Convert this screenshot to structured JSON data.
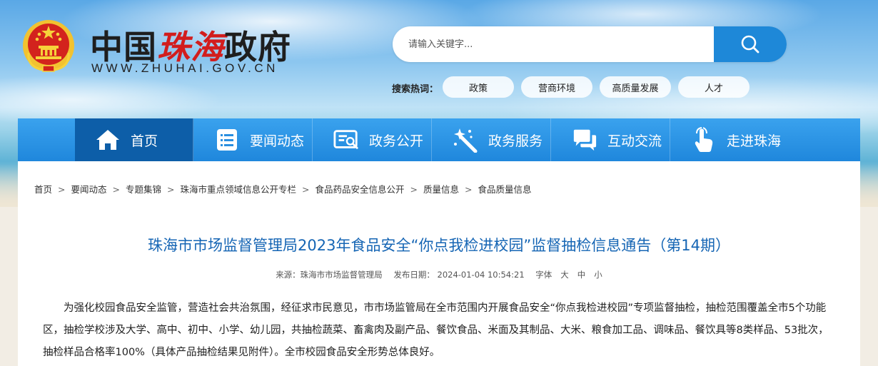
{
  "header": {
    "title_prefix": "中国",
    "title_red": "珠海",
    "title_suffix": "政府",
    "url": "WWW.ZHUHAI.GOV.CN",
    "colors": {
      "accent_red": "#d21d1d",
      "brand_blue": "#1e88d8"
    }
  },
  "search": {
    "placeholder": "请输入关键字...",
    "button_icon": "search-icon",
    "hot_label": "搜索热词：",
    "hot_tags": [
      "政策",
      "营商环境",
      "高质量发展",
      "人才"
    ]
  },
  "nav": {
    "items": [
      {
        "label": "首页",
        "icon": "home-icon",
        "active": true
      },
      {
        "label": "要闻动态",
        "icon": "news-list-icon",
        "active": false
      },
      {
        "label": "政务公开",
        "icon": "document-search-icon",
        "active": false
      },
      {
        "label": "政务服务",
        "icon": "magic-wand-icon",
        "active": false
      },
      {
        "label": "互动交流",
        "icon": "chat-icon",
        "active": false
      },
      {
        "label": "走进珠海",
        "icon": "pointer-hand-icon",
        "active": false
      }
    ]
  },
  "breadcrumb": [
    "首页",
    "要闻动态",
    "专题集锦",
    "珠海市重点领域信息公开专栏",
    "食品药品安全信息公开",
    "质量信息",
    "食品质量信息"
  ],
  "article": {
    "title": "珠海市市场监督管理局2023年食品安全“你点我检进校园”监督抽检信息通告（第14期）",
    "source": "来源：珠海市市场监督管理局",
    "date": "发布日期： 2024-01-04 10:54:21",
    "font_label": "字体",
    "font_sizes": [
      "大",
      "中",
      "小"
    ],
    "paragraph": "为强化校园食品安全监管，营造社会共治氛围，经征求市民意见，市市场监管局在全市范围内开展食品安全“你点我检进校园”专项监督抽检，抽检范围覆盖全市5个功能区，抽检学校涉及大学、高中、初中、小学、幼儿园，共抽检蔬菜、畜禽肉及副产品、餐饮食品、米面及其制品、大米、粮食加工品、调味品、餐饮具等8类样品、53批次，抽检样品合格率100%（具体产品抽检结果见附件）。全市校园食品安全形势总体良好。"
  }
}
